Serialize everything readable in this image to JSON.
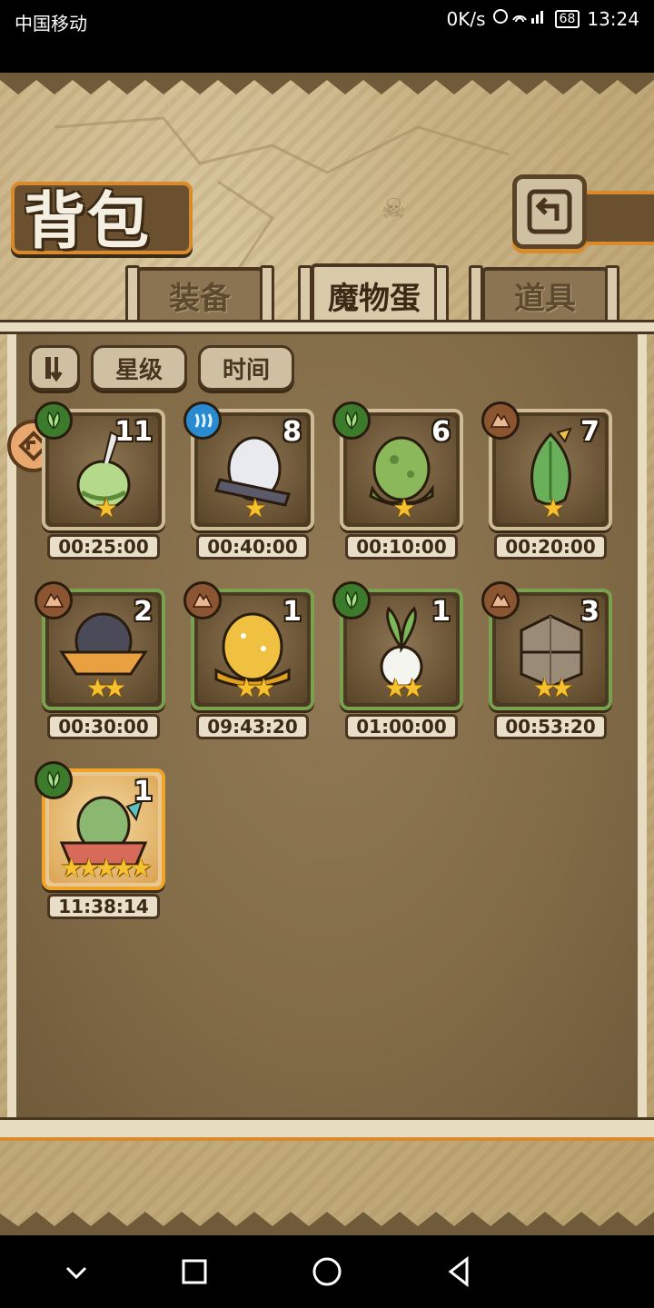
{
  "status_bar": {
    "carrier": "中国移动",
    "speed": "0K/s",
    "battery": "68",
    "time": "13:24"
  },
  "title": "背包",
  "tabs": [
    {
      "label": "装备",
      "active": false
    },
    {
      "label": "魔物蛋",
      "active": true
    },
    {
      "label": "道具",
      "active": false
    }
  ],
  "sort": {
    "star_label": "星级",
    "time_label": "时间"
  },
  "items": [
    {
      "element": "grass",
      "count": "11",
      "stars": "★",
      "timer": "00:25:00",
      "egg": "green-sprout"
    },
    {
      "element": "water",
      "count": "8",
      "stars": "★",
      "timer": "00:40:00",
      "egg": "white-bandage"
    },
    {
      "element": "grass",
      "count": "6",
      "stars": "★",
      "timer": "00:10:00",
      "egg": "green-slime"
    },
    {
      "element": "rock",
      "count": "7",
      "stars": "★",
      "timer": "00:20:00",
      "egg": "leaf-bud"
    },
    {
      "element": "rock",
      "count": "2",
      "stars": "★★",
      "timer": "00:30:00",
      "egg": "dark-hat"
    },
    {
      "element": "rock",
      "count": "1",
      "stars": "★★",
      "timer": "09:43:20",
      "egg": "gold-slime"
    },
    {
      "element": "grass",
      "count": "1",
      "stars": "★★",
      "timer": "01:00:00",
      "egg": "radish"
    },
    {
      "element": "rock",
      "count": "3",
      "stars": "★★",
      "timer": "00:53:20",
      "egg": "stone-golem"
    },
    {
      "element": "grass",
      "count": "1",
      "stars": "★★★★★",
      "timer": "11:38:14",
      "egg": "dragon-nest"
    }
  ],
  "colors": {
    "parchment": "#c8b283",
    "frame_orange": "#d88a2c",
    "star_gold": "#f5c12e",
    "grass": "#3c7a2c",
    "water": "#2a8ad0",
    "rock": "#8a5530"
  }
}
